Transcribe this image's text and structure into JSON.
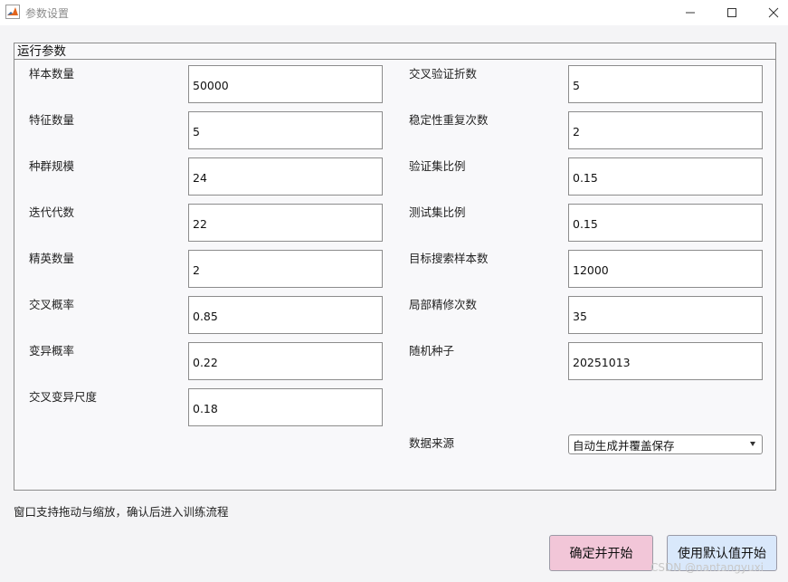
{
  "window": {
    "title": "参数设置",
    "icon": "matlab-icon",
    "controls": [
      "minimize-icon",
      "maximize-icon",
      "close-icon"
    ]
  },
  "panel": {
    "title": "运行参数"
  },
  "left_fields": [
    {
      "label": "样本数量",
      "value": "50000"
    },
    {
      "label": "特征数量",
      "value": "5"
    },
    {
      "label": "种群规模",
      "value": "24"
    },
    {
      "label": "迭代代数",
      "value": "22"
    },
    {
      "label": "精英数量",
      "value": "2"
    },
    {
      "label": "交叉概率",
      "value": "0.85"
    },
    {
      "label": "变异概率",
      "value": "0.22"
    },
    {
      "label": "交叉变异尺度",
      "value": "0.18"
    }
  ],
  "right_fields": [
    {
      "label": "交叉验证折数",
      "value": "5"
    },
    {
      "label": "稳定性重复次数",
      "value": "2"
    },
    {
      "label": "验证集比例",
      "value": "0.15"
    },
    {
      "label": "测试集比例",
      "value": "0.15"
    },
    {
      "label": "目标搜索样本数",
      "value": "12000"
    },
    {
      "label": "局部精修次数",
      "value": "35"
    },
    {
      "label": "随机种子",
      "value": "20251013"
    }
  ],
  "data_source": {
    "label": "数据来源",
    "selected": "自动生成并覆盖保存"
  },
  "hint": "窗口支持拖动与缩放，确认后进入训练流程",
  "buttons": {
    "start": "确定并开始",
    "default": "使用默认值开始"
  },
  "watermark": "CSDN @nantangyuxi",
  "colors": {
    "start_button_bg": "#f2c6d8",
    "default_button_bg": "#d9e8fb",
    "background": "#f4f4f6"
  }
}
